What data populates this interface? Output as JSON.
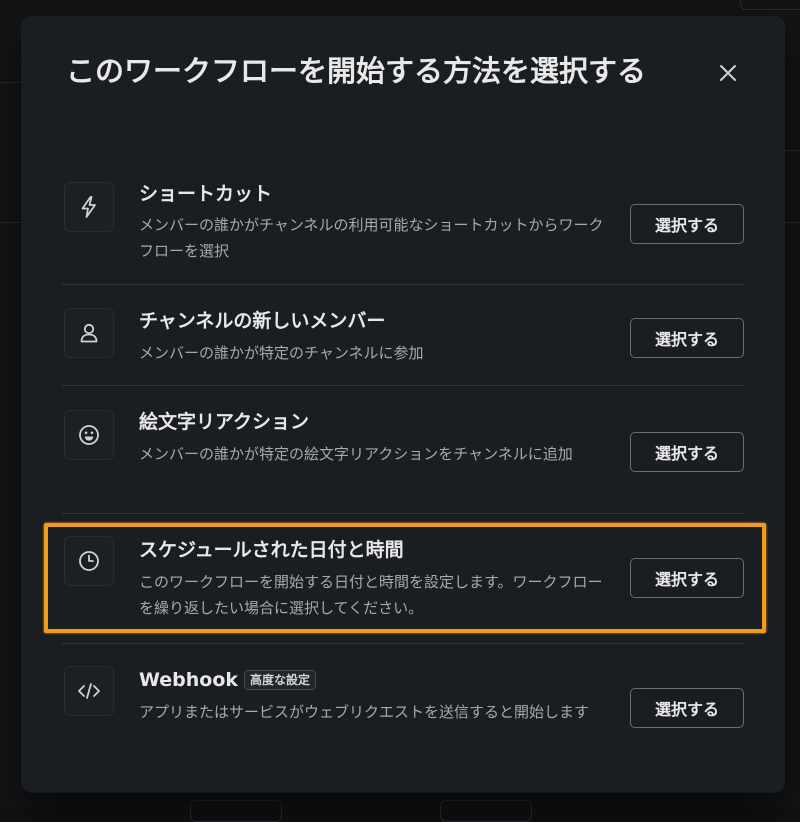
{
  "modal": {
    "title": "このワークフローを開始する方法を選択する",
    "close_icon": "close-icon"
  },
  "options": [
    {
      "icon": "lightning-icon",
      "title": "ショートカット",
      "description": "メンバーの誰かがチャンネルの利用可能なショートカットからワークフローを選択",
      "button": "選択する"
    },
    {
      "icon": "person-icon",
      "title": "チャンネルの新しいメンバー",
      "description": "メンバーの誰かが特定のチャンネルに参加",
      "button": "選択する"
    },
    {
      "icon": "smiley-icon",
      "title": "絵文字リアクション",
      "description": "メンバーの誰かが特定の絵文字リアクションをチャンネルに追加",
      "button": "選択する"
    },
    {
      "icon": "clock-icon",
      "title": "スケジュールされた日付と時間",
      "description": "このワークフローを開始する日付と時間を設定します。ワークフローを繰り返したい場合に選択してください。",
      "button": "選択する"
    },
    {
      "icon": "code-icon",
      "title": "Webhook",
      "badge": "高度な設定",
      "description": "アプリまたはサービスがウェブリクエストを送信すると開始します",
      "button": "選択する"
    }
  ],
  "highlight_color": "#f29a1e",
  "modal_bg": "#1a1d21"
}
